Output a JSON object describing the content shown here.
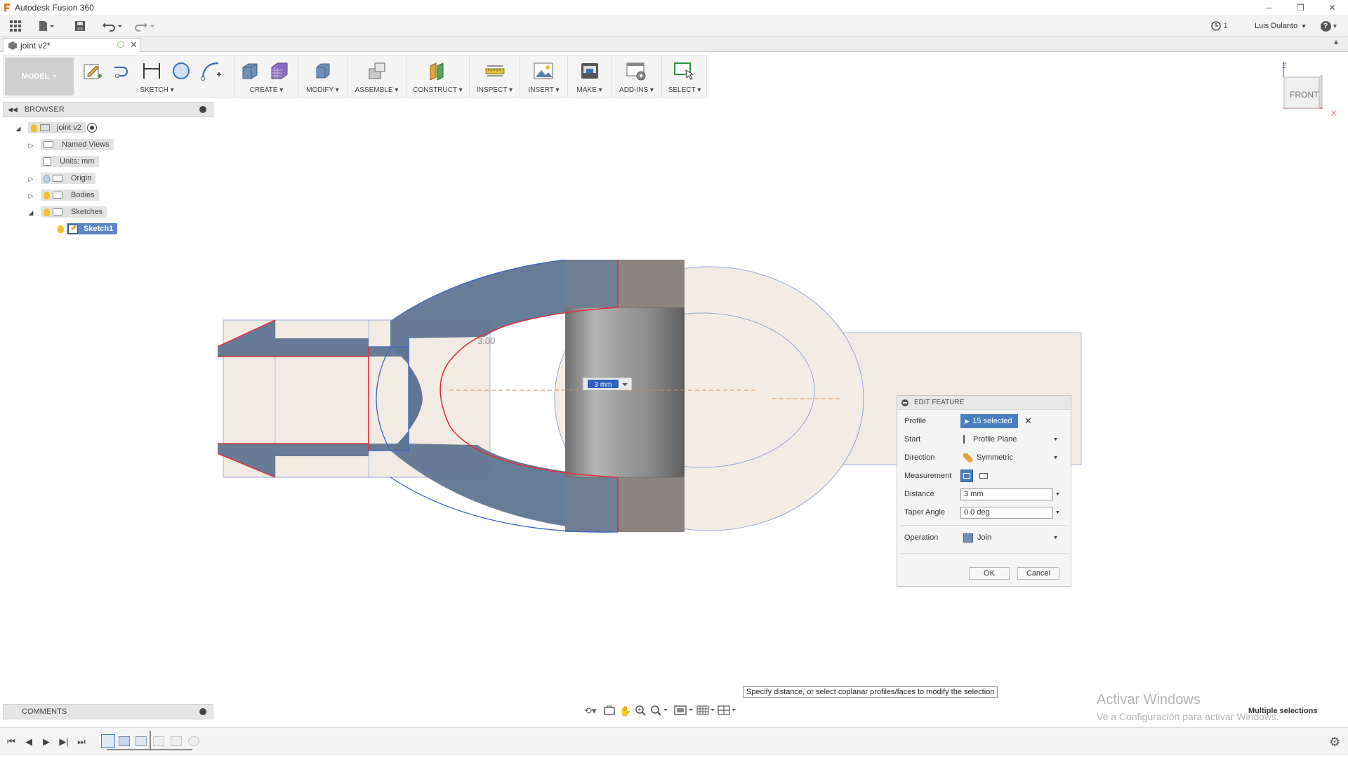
{
  "app": {
    "title": "Autodesk Fusion 360"
  },
  "window_controls": {
    "minimize": "─",
    "restore": "❐",
    "close": "✕"
  },
  "quick_access": {
    "job_status": "1",
    "user": "Luis Dulanto",
    "help": "?"
  },
  "document": {
    "tab_title": "joint v2*"
  },
  "workspace": {
    "label": "MODEL"
  },
  "ribbon": {
    "groups": [
      {
        "label": "SKETCH"
      },
      {
        "label": "CREATE"
      },
      {
        "label": "MODIFY"
      },
      {
        "label": "ASSEMBLE"
      },
      {
        "label": "CONSTRUCT"
      },
      {
        "label": "INSPECT"
      },
      {
        "label": "INSERT"
      },
      {
        "label": "MAKE"
      },
      {
        "label": "ADD-INS"
      },
      {
        "label": "SELECT"
      }
    ]
  },
  "browser": {
    "title": "BROWSER",
    "items": [
      {
        "label": "joint v2"
      },
      {
        "label": "Named Views"
      },
      {
        "label": "Units: mm"
      },
      {
        "label": "Origin"
      },
      {
        "label": "Bodies"
      },
      {
        "label": "Sketches"
      },
      {
        "label": "Sketch1"
      }
    ]
  },
  "viewcube": {
    "face": "FRONT",
    "axis_z": "Z",
    "axis_x": "X"
  },
  "viewport": {
    "dimension_label": "3.00",
    "distance_input": "3 mm"
  },
  "edit_feature": {
    "title": "EDIT FEATURE",
    "profile_label": "Profile",
    "profile_value": "15 selected",
    "start_label": "Start",
    "start_value": "Profile Plane",
    "direction_label": "Direction",
    "direction_value": "Symmetric",
    "measurement_label": "Measurement",
    "distance_label": "Distance",
    "distance_value": "3 mm",
    "taper_label": "Taper Angle",
    "taper_value": "0.0 deg",
    "operation_label": "Operation",
    "operation_value": "Join",
    "ok": "OK",
    "cancel": "Cancel"
  },
  "status": {
    "hint": "Specify distance, or select coplanar profiles/faces to modify the selection",
    "selection": "Multiple selections",
    "watermark_title": "Activar Windows",
    "watermark_sub": "Ve a Configuración para activar Windows."
  },
  "comments": {
    "title": "COMMENTS"
  },
  "colors": {
    "accent": "#4a7fbf",
    "selection_blue": "#5f7591",
    "profile_red": "#e0323c",
    "sketch_line": "#5f80d0"
  }
}
